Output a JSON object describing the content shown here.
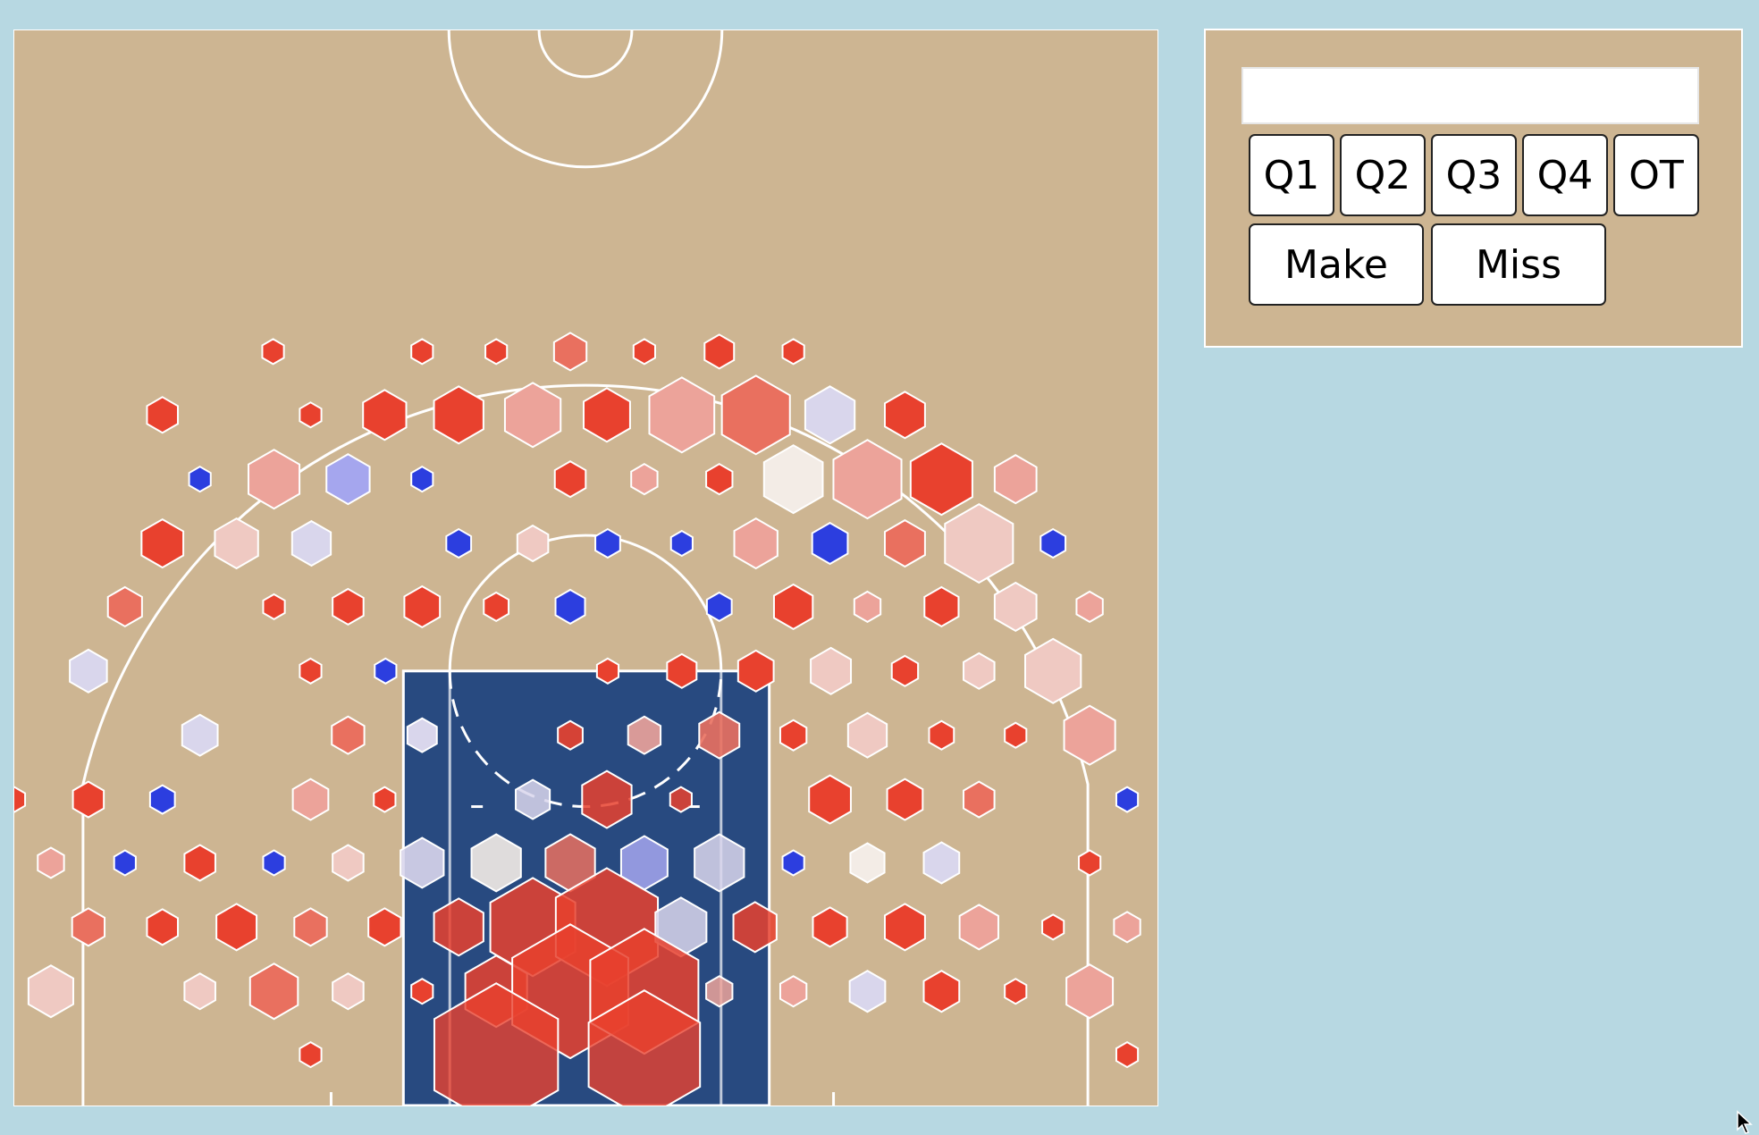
{
  "controls": {
    "search": {
      "value": "",
      "placeholder": ""
    },
    "quarters": [
      "Q1",
      "Q2",
      "Q3",
      "Q4",
      "OT"
    ],
    "results": [
      "Make",
      "Miss"
    ]
  },
  "court": {
    "colors": {
      "floor": "#cdb592",
      "paint": "#284a80",
      "lines": "#ffffff",
      "hot": "#e8412e",
      "cold": "#2c3edf"
    }
  },
  "icons": {
    "cursor": "mouse-pointer-icon"
  }
}
